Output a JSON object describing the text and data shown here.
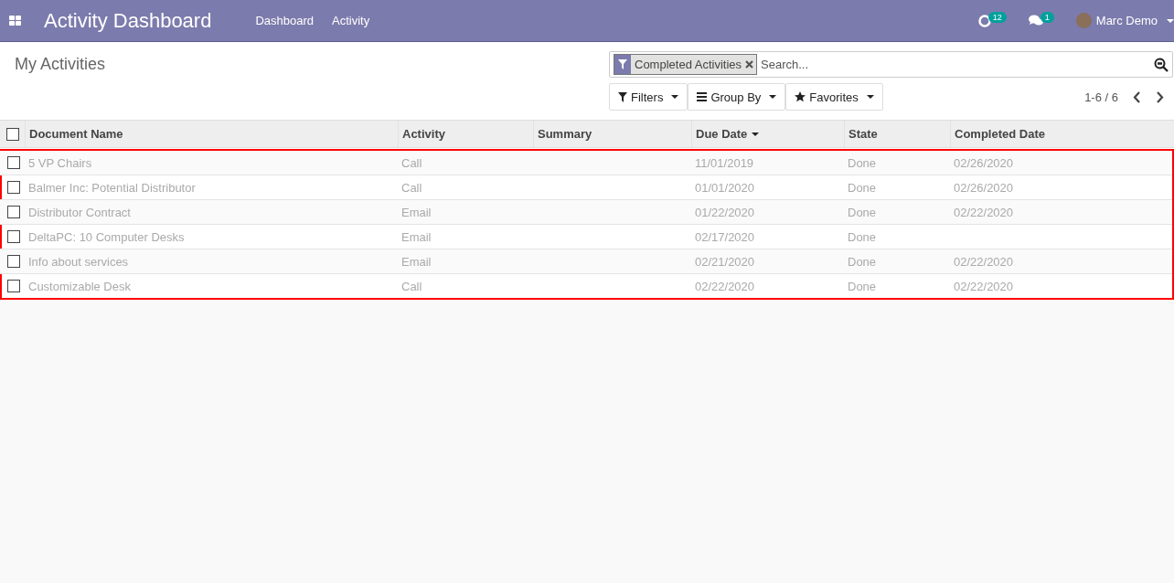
{
  "navbar": {
    "app_title": "Activity Dashboard",
    "menu": [
      {
        "label": "Dashboard"
      },
      {
        "label": "Activity"
      }
    ],
    "activity_count": "12",
    "message_count": "1",
    "user": "Marc Demo"
  },
  "breadcrumb": "My Activities",
  "search": {
    "facets": [
      {
        "label": "Completed Activities"
      }
    ],
    "placeholder": "Search..."
  },
  "search_buttons": [
    {
      "kind": "filter",
      "label": "Filters"
    },
    {
      "kind": "group",
      "label": "Group By"
    },
    {
      "kind": "favorite",
      "label": "Favorites"
    }
  ],
  "pager": "1-6 / 6",
  "table": {
    "select_all_checked": false,
    "columns": [
      {
        "label": "Document Name",
        "sorted": false
      },
      {
        "label": "Activity",
        "sorted": false
      },
      {
        "label": "Summary",
        "sorted": false
      },
      {
        "label": "Due Date",
        "sorted": true
      },
      {
        "label": "State",
        "sorted": false
      },
      {
        "label": "Completed Date",
        "sorted": false
      }
    ],
    "rows": [
      {
        "checked": false,
        "cells": [
          "5 VP Chairs",
          "Call",
          "",
          "11/01/2019",
          "Done",
          "02/26/2020"
        ]
      },
      {
        "checked": false,
        "cells": [
          "Balmer Inc: Potential Distributor",
          "Call",
          "",
          "01/01/2020",
          "Done",
          "02/26/2020"
        ]
      },
      {
        "checked": false,
        "cells": [
          "Distributor Contract",
          "Email",
          "",
          "01/22/2020",
          "Done",
          "02/22/2020"
        ]
      },
      {
        "checked": false,
        "cells": [
          "DeltaPC: 10 Computer Desks",
          "Email",
          "",
          "02/17/2020",
          "Done",
          ""
        ]
      },
      {
        "checked": false,
        "cells": [
          "Info about services",
          "Email",
          "",
          "02/21/2020",
          "Done",
          "02/22/2020"
        ]
      },
      {
        "checked": false,
        "cells": [
          "Customizable Desk",
          "Call",
          "",
          "02/22/2020",
          "Done",
          "02/22/2020"
        ]
      }
    ]
  }
}
